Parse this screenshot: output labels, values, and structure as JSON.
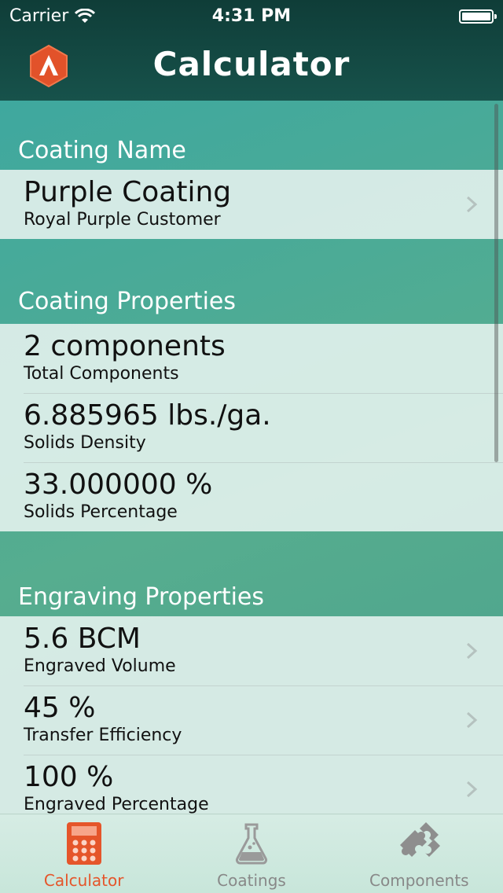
{
  "status_bar": {
    "carrier": "Carrier",
    "time": "4:31 PM"
  },
  "nav": {
    "title": "Calculator",
    "logo_icon": "brand-logo-icon"
  },
  "sections": {
    "coating_name": {
      "header": "Coating Name",
      "rows": [
        {
          "title": "Purple Coating",
          "subtitle": "Royal Purple Customer"
        }
      ]
    },
    "coating_properties": {
      "header": "Coating Properties",
      "rows": [
        {
          "title": "2 components",
          "subtitle": "Total Components"
        },
        {
          "title": "6.885965 lbs./ga.",
          "subtitle": "Solids Density"
        },
        {
          "title": "33.000000 %",
          "subtitle": "Solids Percentage"
        }
      ]
    },
    "engraving_properties": {
      "header": "Engraving Properties",
      "rows": [
        {
          "title": "5.6 BCM",
          "subtitle": "Engraved Volume"
        },
        {
          "title": "45 %",
          "subtitle": "Transfer Efficiency"
        },
        {
          "title": "100 %",
          "subtitle": "Engraved Percentage"
        }
      ]
    }
  },
  "tabs": [
    {
      "label": "Calculator",
      "icon": "calculator-icon",
      "active": true
    },
    {
      "label": "Coatings",
      "icon": "flask-icon",
      "active": false
    },
    {
      "label": "Components",
      "icon": "puzzle-icon",
      "active": false
    }
  ],
  "colors": {
    "accent": "#e5552a",
    "header_bg": "#17524b",
    "teal": "#3aa7a2"
  }
}
